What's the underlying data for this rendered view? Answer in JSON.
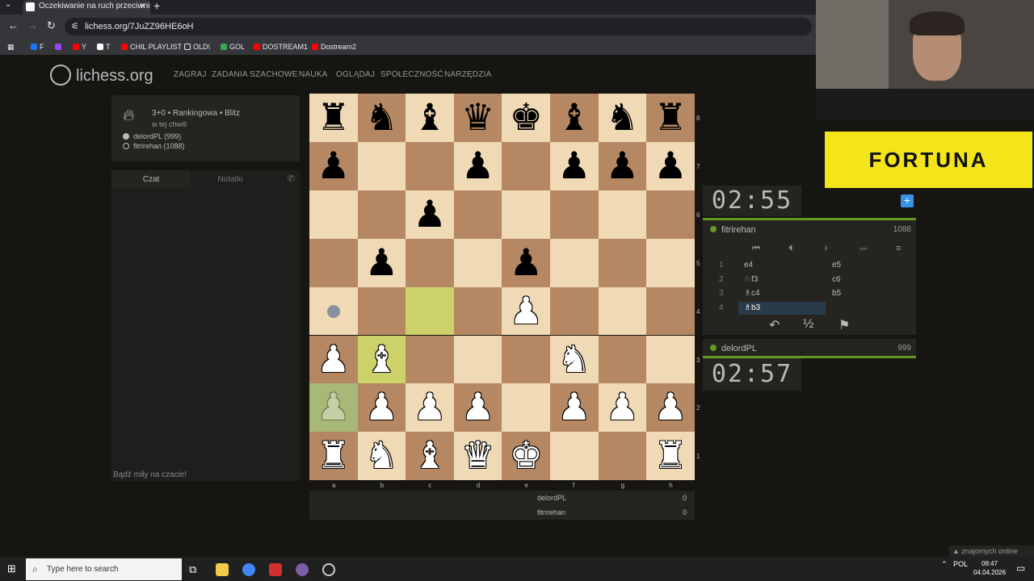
{
  "browser": {
    "tab_title": "Oczekiwanie na ruch przeciwnika",
    "url": "lichess.org/7JuZZ96HE6oH",
    "bookmarks": [
      {
        "label": "F",
        "color": "#1877f2"
      },
      {
        "label": "",
        "color": "#9146ff"
      },
      {
        "label": "Y",
        "color": "#ff0000"
      },
      {
        "label": "T",
        "color": "#ffffff"
      },
      {
        "label": "CHIL PLAYLIST",
        "color": "#ff0000"
      },
      {
        "label": "OLD\\",
        "color": "#e8eaed"
      },
      {
        "label": "GOL",
        "color": "#34a853"
      },
      {
        "label": "DOSTREAM1",
        "color": "#ff0000"
      },
      {
        "label": "Dostream2",
        "color": "#ff0000"
      }
    ]
  },
  "site": {
    "logo": "lichess.org",
    "menu": [
      "ZAGRAJ",
      "ZADANIA SZACHOWE",
      "NAUKA",
      "OGLĄDAJ",
      "SPOŁECZNOŚĆ",
      "NARZĘDZIA"
    ]
  },
  "game_info": {
    "type": "3+0 • Rankingowa • Blitz",
    "time": "w tej chwili",
    "white": "delordPL (999)",
    "black": "fitrirehan (1088)"
  },
  "chat": {
    "tab_chat": "Czat",
    "tab_notes": "Notatki",
    "placeholder": "Bądź miły na czacie!"
  },
  "board": {
    "files": [
      "a",
      "b",
      "c",
      "d",
      "e",
      "f",
      "g",
      "h"
    ],
    "ranks": [
      "8",
      "7",
      "6",
      "5",
      "4",
      "3",
      "2",
      "1"
    ],
    "position": [
      [
        "bR",
        "bN",
        "bB",
        "bQ",
        "bK",
        "bB",
        "bN",
        "bR"
      ],
      [
        "bP",
        "",
        "",
        "bP",
        "",
        "bP",
        "bP",
        "bP"
      ],
      [
        "",
        "",
        "bP",
        "",
        "",
        "",
        "",
        ""
      ],
      [
        "",
        "bP",
        "",
        "",
        "bP",
        "",
        "",
        ""
      ],
      [
        "",
        "",
        "",
        "",
        "wP",
        "",
        "",
        ""
      ],
      [
        "wP",
        "wB",
        "",
        "",
        "",
        "wN",
        "",
        ""
      ],
      [
        "ghost",
        "wP",
        "wP",
        "wP",
        "",
        "wP",
        "wP",
        "wP"
      ],
      [
        "wR",
        "wN",
        "wB",
        "wQ",
        "wK",
        "",
        "",
        "wR"
      ]
    ],
    "highlight": [
      "c4",
      "b3"
    ],
    "ghost_square": "a2",
    "premove_dot": "a4",
    "colors": {
      "light": "#f0d9b5",
      "dark": "#b58863",
      "highlight": "#cdd16a",
      "ghost": "#a8b878"
    }
  },
  "score": {
    "p1": {
      "name": "delordPL",
      "score": "0"
    },
    "p2": {
      "name": "fitrirehan",
      "score": "0"
    }
  },
  "clocks": {
    "top": "02:55",
    "bottom": "02:57"
  },
  "top_player": {
    "name": "fitrirehan",
    "rating": "1088"
  },
  "bottom_player": {
    "name": "delordPL",
    "rating": "999"
  },
  "moves": [
    {
      "n": "1",
      "w": "e4",
      "b": "e5"
    },
    {
      "n": "2",
      "w": "♘f3",
      "b": "c6"
    },
    {
      "n": "3",
      "w": "♗c4",
      "b": "b5"
    },
    {
      "n": "4",
      "w": "♗b3",
      "b": ""
    }
  ],
  "actions": {
    "takeback": "↶",
    "draw": "½",
    "resign": "⚑"
  },
  "overlay": {
    "sponsor": "FORTUNA",
    "friends": "znajomych online"
  },
  "taskbar": {
    "search": "Type here to search",
    "lang": "POL",
    "time": "08:47",
    "date": "04.04.2026"
  }
}
